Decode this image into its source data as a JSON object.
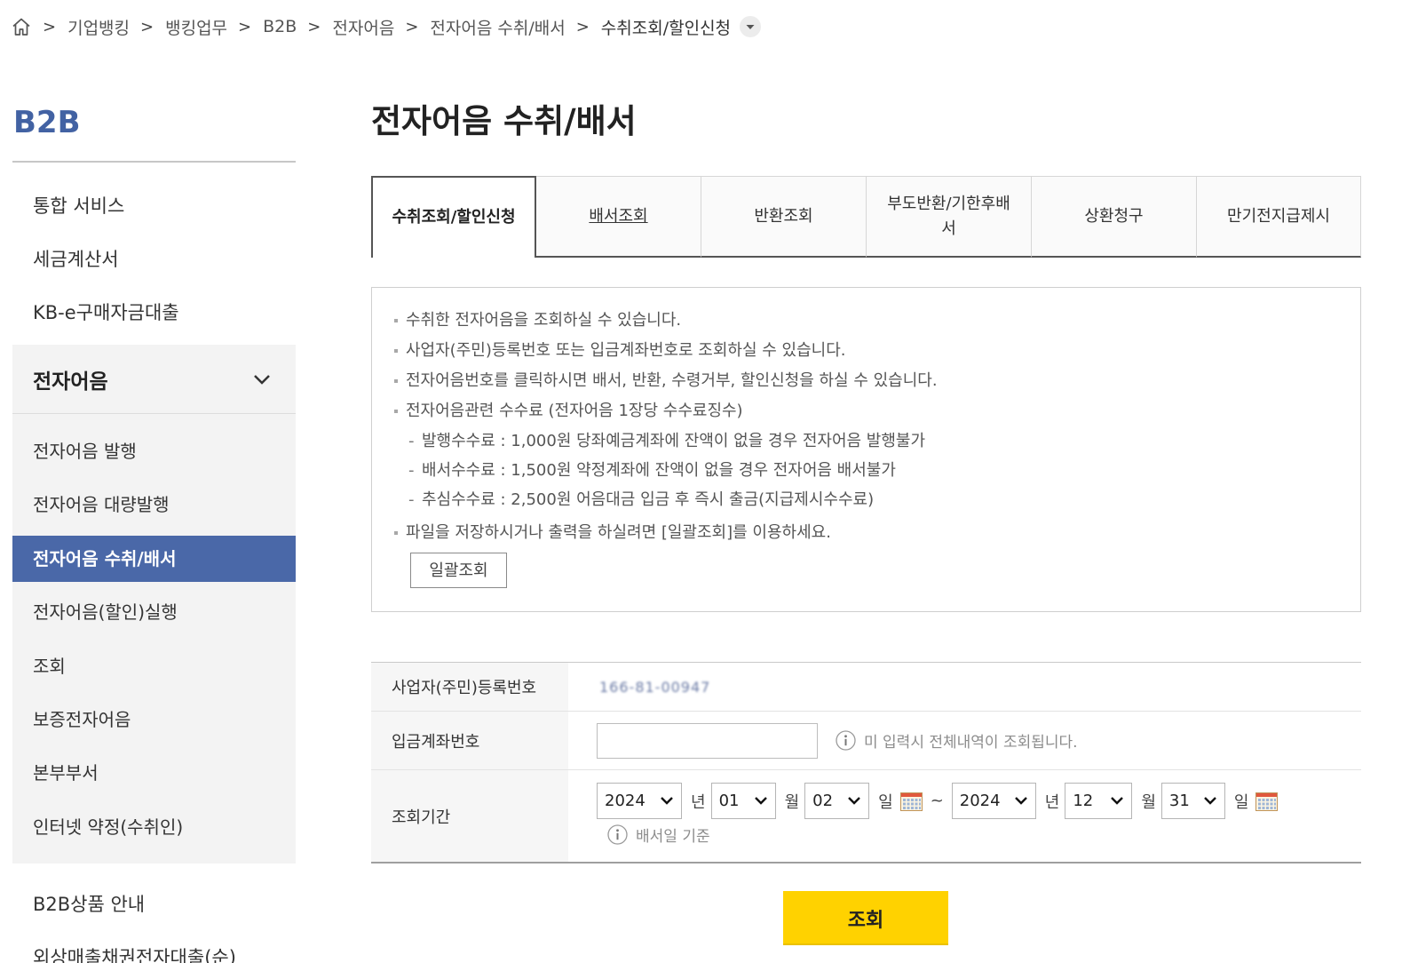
{
  "breadcrumb": {
    "home_icon": "home-icon",
    "separator": ">",
    "items": [
      "기업뱅킹",
      "뱅킹업무",
      "B2B",
      "전자어음",
      "전자어음 수취/배서",
      "수취조회/할인신청"
    ],
    "dropdown_icon": "chevron-down-icon"
  },
  "sidebar": {
    "title": "B2B",
    "top_items": [
      "통합 서비스",
      "세금계산서",
      "KB-e구매자금대출"
    ],
    "section": {
      "label": "전자어음",
      "expanded": true,
      "items": [
        "전자어음 발행",
        "전자어음 대량발행",
        "전자어음 수취/배서",
        "전자어음(할인)실행",
        "조회",
        "보증전자어음",
        "본부부서",
        "인터넷 약정(수취인)"
      ],
      "selected_index": 2
    },
    "bottom_items": [
      "B2B상품 안내",
      "외상매출채권전자대출(순)"
    ]
  },
  "main": {
    "title": "전자어음 수취/배서",
    "tabs": [
      {
        "label": "수취조회/할인신청",
        "active": true
      },
      {
        "label": "배서조회",
        "active": false
      },
      {
        "label": "반환조회",
        "active": false
      },
      {
        "label": "부도반환/기한후배서",
        "active": false
      },
      {
        "label": "상환청구",
        "active": false
      },
      {
        "label": "만기전지급제시",
        "active": false
      }
    ]
  },
  "notice": {
    "items": [
      "수취한 전자어음을 조회하실 수 있습니다.",
      "사업자(주민)등록번호 또는 입금계좌번호로 조회하실 수 있습니다.",
      "전자어음번호를 클릭하시면 배서, 반환, 수령거부, 할인신청을 하실 수 있습니다.",
      "전자어음관련 수수료 (전자어음 1장당 수수료징수)"
    ],
    "sub_marker": "-",
    "fee_items": [
      "발행수수료 : 1,000원 당좌예금계좌에 잔액이 없을 경우 전자어음 발행불가",
      "배서수수료 : 1,500원 약정계좌에 잔액이 없을 경우 전자어음 배서불가",
      "추심수수료 : 2,500원 어음대금 입금 후 즉시 출금(지급제시수수료)"
    ],
    "last_item": "파일을 저장하시거나 출력을 하실려면 [일괄조회]를 이용하세요.",
    "batch_button": "일괄조회"
  },
  "form": {
    "business_number": {
      "label": "사업자(주민)등록번호",
      "value": "166-81-00947"
    },
    "account": {
      "label": "입금계좌번호",
      "value": "",
      "hint": "미 입력시 전체내역이 조회됩니다."
    },
    "period": {
      "label": "조회기간",
      "from": {
        "year": "2024",
        "month": "01",
        "day": "02"
      },
      "to": {
        "year": "2024",
        "month": "12",
        "day": "31"
      },
      "year_unit": "년",
      "month_unit": "월",
      "day_unit": "일",
      "range_separator": "~",
      "hint": "배서일 기준"
    }
  },
  "submit_button": "조회",
  "colors": {
    "brand": "#4262a3",
    "selected_menu_bg": "#4a68a8",
    "submit_bg": "#ffd200"
  }
}
